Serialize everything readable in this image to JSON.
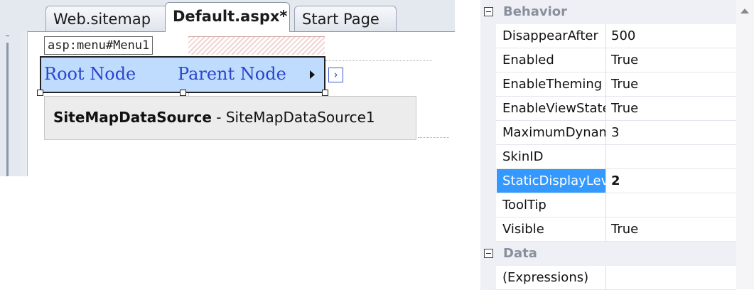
{
  "designer": {
    "tabs": [
      {
        "label": "Web.sitemap",
        "active": false
      },
      {
        "label": "Default.aspx*",
        "active": true
      },
      {
        "label": "Start Page",
        "active": false
      }
    ],
    "control_label": "asp:menu#Menu1",
    "menu_items": [
      "Root Node",
      "Parent Node"
    ],
    "chevron_glyph": "›",
    "datasource_type": "SiteMapDataSource",
    "datasource_separator": " - ",
    "datasource_id": "SiteMapDataSource1"
  },
  "properties": {
    "categories": [
      {
        "name": "Behavior",
        "rows": [
          {
            "name": "DisappearAfter",
            "value": "500"
          },
          {
            "name": "Enabled",
            "value": "True"
          },
          {
            "name": "EnableTheming",
            "value": "True"
          },
          {
            "name": "EnableViewState",
            "value": "True"
          },
          {
            "name": "MaximumDynamicDisplayLevels",
            "value": "3"
          },
          {
            "name": "SkinID",
            "value": ""
          },
          {
            "name": "StaticDisplayLevels",
            "value": "2",
            "selected": true
          },
          {
            "name": "ToolTip",
            "value": ""
          },
          {
            "name": "Visible",
            "value": "True"
          }
        ]
      },
      {
        "name": "Data",
        "rows": [
          {
            "name": "(Expressions)",
            "value": ""
          }
        ]
      }
    ]
  },
  "colors": {
    "menu_link": "#2a45c9",
    "menu_background": "#bfdcff",
    "selection": "#3399ff",
    "category_text": "#8a8f9c"
  }
}
